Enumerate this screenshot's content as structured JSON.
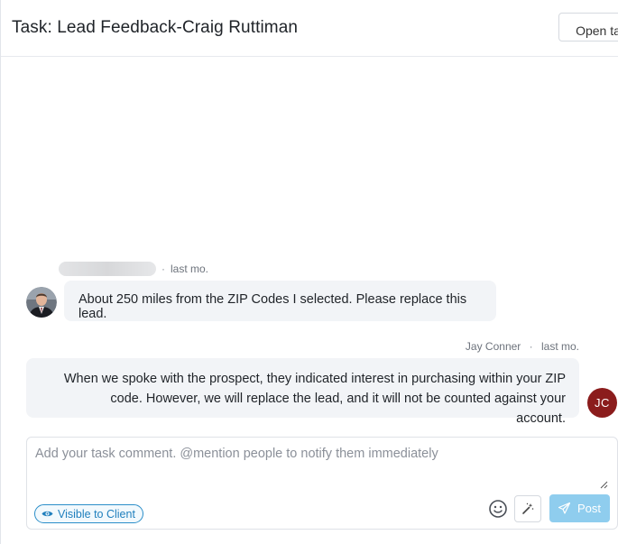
{
  "header": {
    "title": "Task: Lead Feedback-Craig Ruttiman",
    "open_task_label": "Open task"
  },
  "messages": [
    {
      "author": "",
      "separator": "·",
      "time": "last mo.",
      "text": "About 250 miles from the ZIP Codes I selected. Please replace this lead."
    },
    {
      "author": "Jay Conner",
      "separator": "·",
      "time": "last mo.",
      "text": "When we spoke with the prospect, they indicated interest in purchasing within your ZIP code. However, we will replace the lead, and it will not be counted against your account.",
      "initials": "JC"
    }
  ],
  "composer": {
    "placeholder": "Add your task comment. @mention people to notify them immediately",
    "value": "",
    "visibility_label": "Visible to Client",
    "post_label": "Post"
  },
  "icons": {
    "visibility": "eye-icon",
    "emoji": "smiley-icon",
    "assist": "magic-wand-icon",
    "post": "send-icon",
    "resize": "resize-grip-icon"
  },
  "colors": {
    "accent": "#2b8ec9",
    "post_button": "#8fcdee",
    "bubble_background": "#f2f4f7",
    "initials_avatar": "#8b1c1c"
  }
}
